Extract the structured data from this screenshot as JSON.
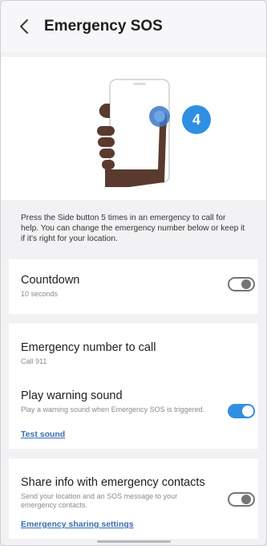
{
  "header": {
    "title": "Emergency SOS",
    "back_icon": "chevron-left-icon"
  },
  "illustration": {
    "step_badge": "4"
  },
  "description": "Press the Side button 5 times in an emergency to call for help. You can change the emergency number below or keep it if it's right for your location.",
  "settings": {
    "countdown": {
      "title": "Countdown",
      "subtitle": "10 seconds",
      "enabled": false
    },
    "emergency_number": {
      "title": "Emergency number to call",
      "subtitle": "Call 911"
    },
    "warning_sound": {
      "title": "Play warning sound",
      "subtitle": "Play a warning sound when Emergency SOS is triggered.",
      "link": "Test sound",
      "enabled": true
    },
    "share_info": {
      "title": "Share info with emergency contacts",
      "subtitle": "Send your location and an SOS message to your emergency contacts.",
      "link": "Emergency sharing settings",
      "enabled": false
    }
  },
  "colors": {
    "accent": "#2f8fe3",
    "link": "#3a6fb0"
  }
}
